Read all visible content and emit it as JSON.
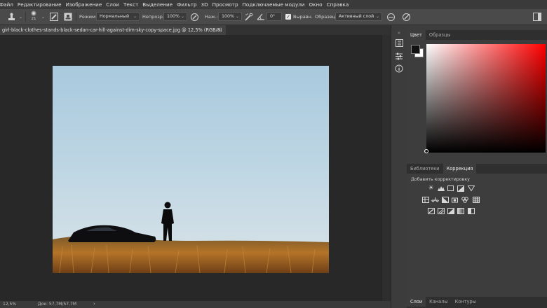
{
  "menu": [
    "Файл",
    "Редактирование",
    "Изображение",
    "Слои",
    "Текст",
    "Выделение",
    "Фильтр",
    "3D",
    "Просмотр",
    "Подключаемые модули",
    "Окно",
    "Справка"
  ],
  "options": {
    "brush_size": "21",
    "mode_label": "Режим:",
    "mode_value": "Нормальный",
    "opacity_label": "Непрозр.:",
    "opacity_value": "100%",
    "pressure_label": "Наж.:",
    "pressure_value": "100%",
    "angle_value": "0°",
    "align_label": "Выравн.",
    "sample_label": "Образец:",
    "sample_value": "Активный слой"
  },
  "document_tab": {
    "title": "girl-black-clothes-stands-black-sedan-car-hill-against-dim-sky-copy-space.jpg @ 12,5% (RGB/8)",
    "close": "×"
  },
  "status_bar": {
    "zoom": "12,5%",
    "doc_size": "Док: 57,7M/57,7M",
    "arrow": "›"
  },
  "color_panel": {
    "tabs": [
      "Цвет",
      "Образцы"
    ],
    "active_tab": "Цвет",
    "fg_color": "#111111",
    "bg_color": "#ffffff"
  },
  "adjust_panel": {
    "tabs": [
      "Библиотеки",
      "Коррекция"
    ],
    "active_tab": "Коррекция",
    "caption": "Добавить корректировку"
  },
  "layers_panel": {
    "tabs": [
      "Слои",
      "Каналы",
      "Контуры"
    ],
    "active_tab": "Слои"
  },
  "icons": {
    "tool_preset": "clone-stamp-icon",
    "brush_preset": "brush-preview-icon",
    "toggle_brush_panel": "brush-settings-icon",
    "toggle_clone_source": "clone-source-icon",
    "pressure_opacity": "pressure-opacity-icon",
    "airbrush": "airbrush-icon",
    "angle": "angle-icon",
    "ignore_adjustment": "ignore-adjustment-icon",
    "pressure_size": "pressure-size-icon"
  },
  "colors": {
    "accent": "#1473e6",
    "chrome_dark": "#282828",
    "panel": "#3d3d3d"
  }
}
